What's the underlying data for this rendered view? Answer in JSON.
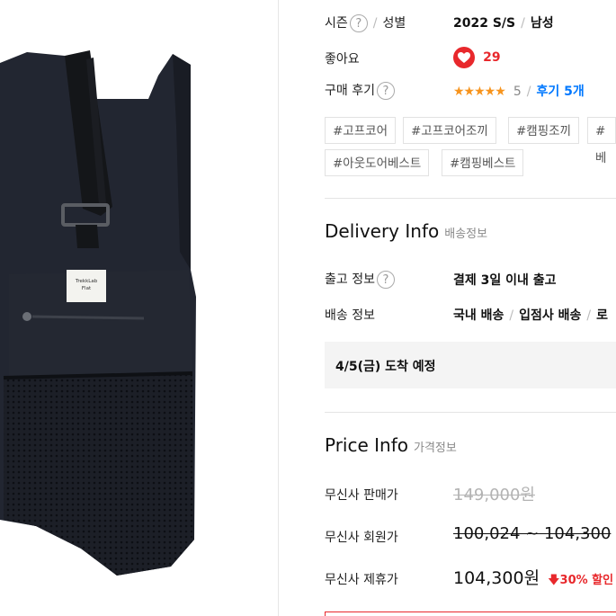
{
  "product": {
    "image_alt": "black utility vest",
    "patch_text": [
      "TrekkLab",
      "Flat"
    ]
  },
  "info": {
    "season_label": "시즌",
    "gender_label": "성별",
    "season_value": "2022 S/S",
    "gender_value": "남성",
    "likes_label": "좋아요",
    "likes_count": "29",
    "review_label": "구매 후기",
    "rating_stars": "★★★★★",
    "rating_score": "5",
    "review_link": "후기 5개",
    "help_glyph": "?",
    "separator": "/"
  },
  "tags": [
    "#고프코어",
    "#고프코어조끼",
    "#캠핑조끼",
    "#베",
    "#아웃도어베스트",
    "#캠핑베스트"
  ],
  "delivery": {
    "title": "Delivery Info",
    "subtitle": "배송정보",
    "release_label": "출고 정보",
    "release_value": "결제 3일 이내 출고",
    "shipping_label": "배송 정보",
    "shipping_values": [
      "국내 배송",
      "입점사 배송",
      "로"
    ],
    "eta": "4/5(금) 도착 예정"
  },
  "price": {
    "title": "Price Info",
    "subtitle": "가격정보",
    "sale_label": "무신사 판매가",
    "sale_value": "149,000원",
    "member_label": "무신사 회원가",
    "member_value": "100,024 ~ 104,300",
    "partner_label": "무신사 제휴가",
    "partner_value": "104,300원",
    "discount_arrow": "🡇",
    "discount_text": "30% 할인"
  },
  "colors": {
    "accent_red": "#e8282c",
    "link_blue": "#0078ff",
    "star_orange": "#f7941d"
  }
}
